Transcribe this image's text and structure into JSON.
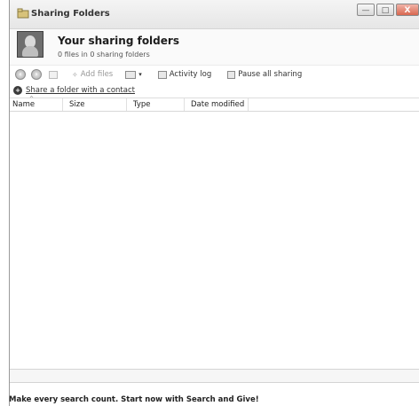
{
  "window": {
    "title": "Sharing Folders",
    "controls": {
      "minimize": "—",
      "maximize": "□",
      "close": "X"
    }
  },
  "header": {
    "title": "Your sharing folders",
    "subtitle": "0 files in 0 sharing folders"
  },
  "toolbar": {
    "back_icon": "back-arrow-icon",
    "forward_icon": "forward-arrow-icon",
    "add_files": "Add files",
    "activity_log": "Activity log",
    "pause_all": "Pause all sharing"
  },
  "share_link": "Share a folder with a contact",
  "columns": [
    "Name",
    "Size",
    "Type",
    "Date modified"
  ],
  "footer": "Make every search count. Start now with Search and Give!"
}
